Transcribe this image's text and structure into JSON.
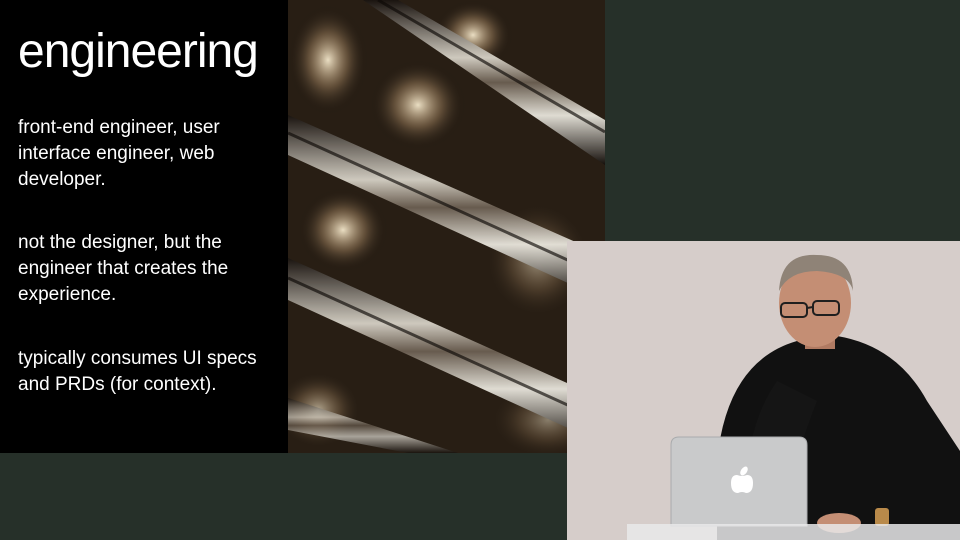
{
  "slide": {
    "title": "engineering",
    "paragraphs": [
      "front-end engineer, user interface engineer, web developer.",
      "not the designer, but the engineer that creates the experience.",
      "typically consumes UI specs and PRDs (for context)."
    ]
  },
  "colors": {
    "background": "#263029",
    "slide_background": "#000000",
    "slide_text": "#ffffff",
    "wall": "#cfc7c3"
  },
  "icons": {
    "laptop_logo": "apple-logo-icon"
  }
}
